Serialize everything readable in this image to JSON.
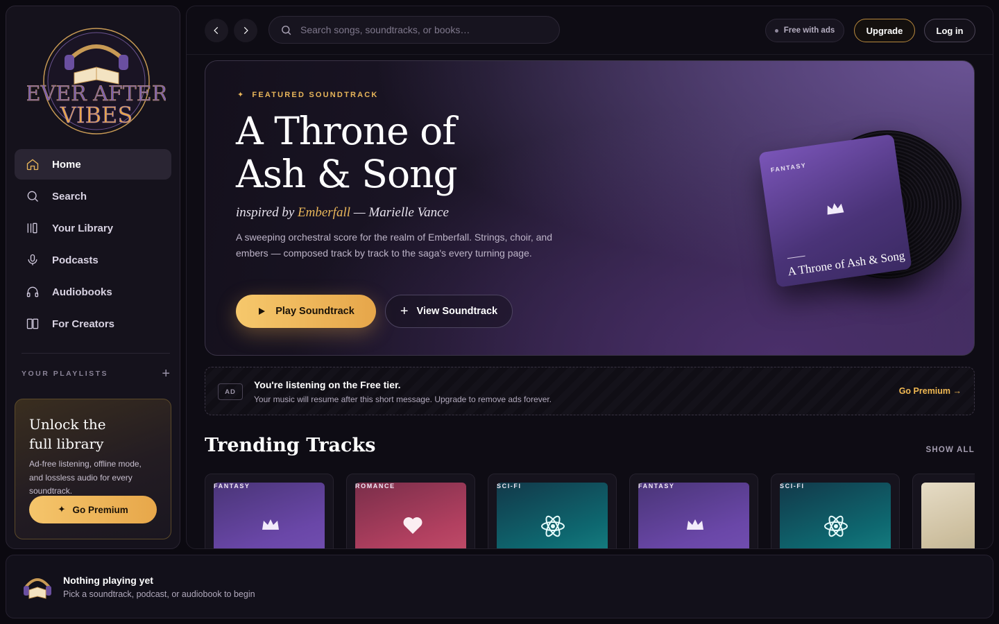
{
  "brand": {
    "line1": "EVER AFTER",
    "line2": "VIBES"
  },
  "nav": [
    {
      "label": "Home",
      "icon": "home-icon",
      "active": true
    },
    {
      "label": "Search",
      "icon": "search-icon"
    },
    {
      "label": "Your Library",
      "icon": "library-icon"
    },
    {
      "label": "Podcasts",
      "icon": "microphone-icon"
    },
    {
      "label": "Audiobooks",
      "icon": "headphones-icon"
    },
    {
      "label": "For Creators",
      "icon": "book-open-icon"
    }
  ],
  "playlists": {
    "title": "YOUR PLAYLISTS",
    "add": "+"
  },
  "promo": {
    "title": "Unlock the full library",
    "body": "Ad-free listening, offline mode, and lossless audio for every soundtrack.",
    "button": "Go Premium"
  },
  "topbar": {
    "search_placeholder": "Search songs, soundtracks, or books…",
    "free_label": "Free with ads",
    "upgrade_label": "Upgrade",
    "login_label": "Log in"
  },
  "hero": {
    "eyebrow": "FEATURED SOUNDTRACK",
    "title_line1": "A Throne of",
    "title_line2": "Ash & Song",
    "inspired_prefix": "inspired by",
    "book": "Emberfall",
    "author": "— Marielle Vance",
    "description": "A sweeping orchestral score for the realm of Emberfall. Strings, choir, and embers — composed track by track to the saga's every turning page.",
    "play_label": "Play Soundtrack",
    "view_label": "View Soundtrack",
    "cover_genre": "FANTASY",
    "cover_title": "A Throne of Ash & Song"
  },
  "ad": {
    "badge": "AD",
    "title": "You're listening on the Free tier.",
    "subtitle": "Your music will resume after this short message. Upgrade to remove ads forever.",
    "cta": "Go Premium →"
  },
  "trending": {
    "title": "Trending Tracks",
    "show_all": "SHOW ALL",
    "cards": [
      {
        "genre": "FANTASY",
        "icon": "crown-icon"
      },
      {
        "genre": "ROMANCE",
        "icon": "heart-icon"
      },
      {
        "genre": "SCI-FI",
        "icon": "atom-icon"
      },
      {
        "genre": "FANTASY",
        "icon": "crown-icon"
      },
      {
        "genre": "SCI-FI",
        "icon": "atom-icon"
      },
      {
        "genre": "",
        "icon": "book-cover-image"
      }
    ]
  },
  "player": {
    "title": "Nothing playing yet",
    "subtitle": "Pick a soundtrack, podcast, or audiobook to begin"
  },
  "colors": {
    "accent": "#e9b65a",
    "background": "#0b0910",
    "panel": "#15121c"
  }
}
